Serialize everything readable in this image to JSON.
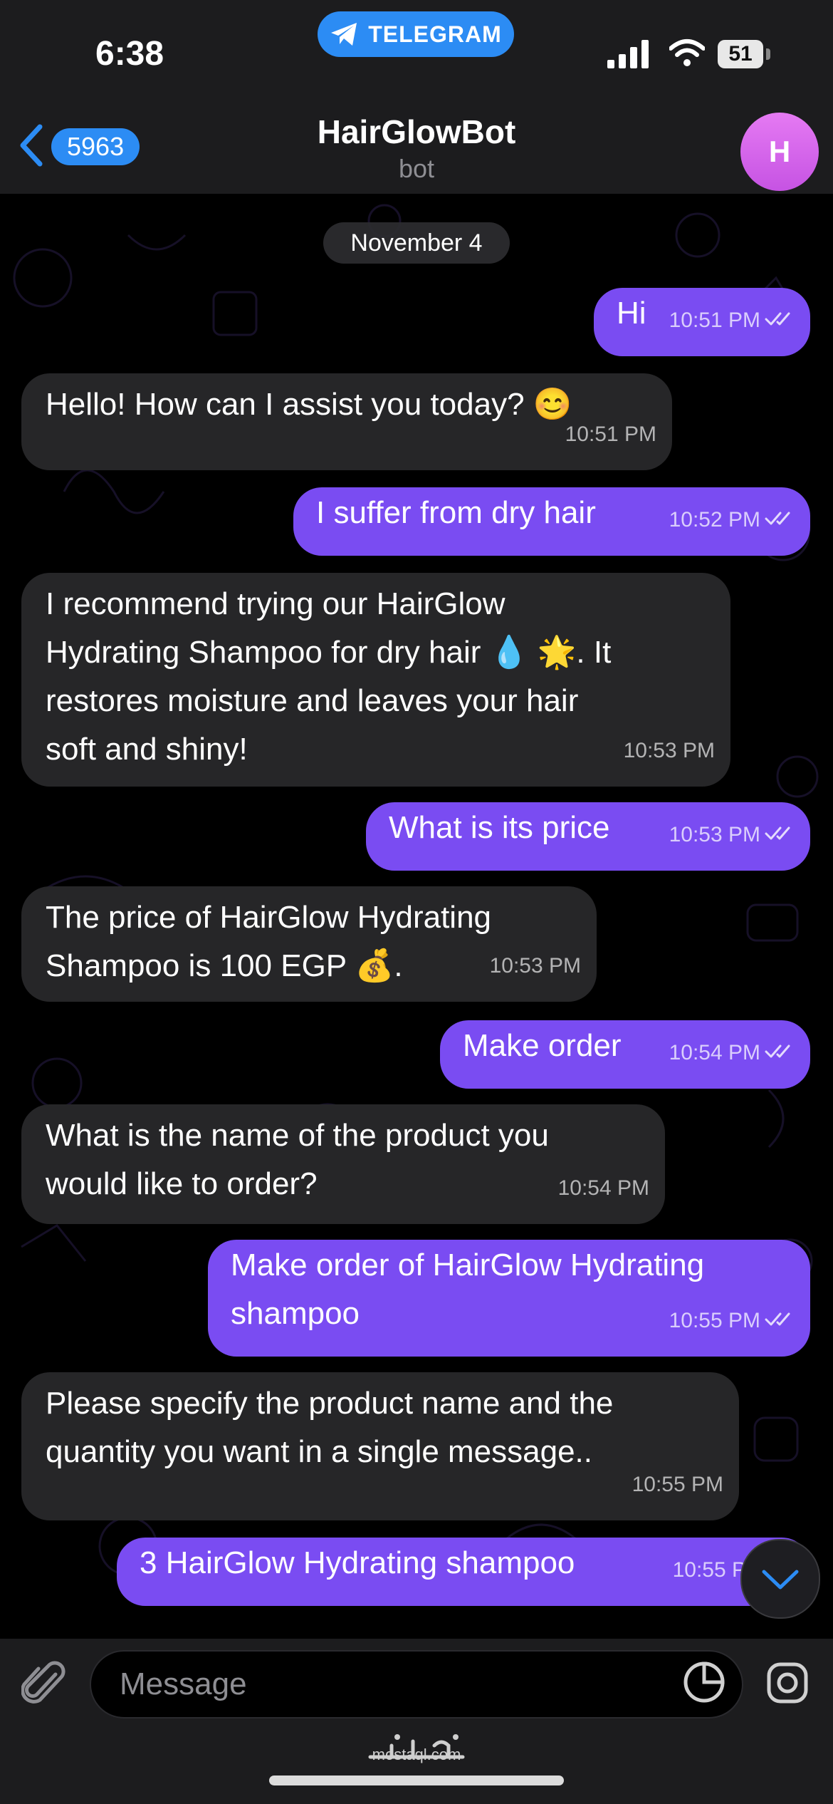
{
  "status_bar": {
    "time": "6:38",
    "app_pill": "TELEGRAM",
    "battery": "51"
  },
  "header": {
    "back_count": "5963",
    "title": "HairGlowBot",
    "subtitle": "bot",
    "avatar_letter": "H"
  },
  "date_chip": "November 4",
  "messages": [
    {
      "dir": "out",
      "text": "Hi",
      "time": "10:51 PM"
    },
    {
      "dir": "in",
      "text": "Hello! How can I assist you today? 😊",
      "time": "10:51 PM"
    },
    {
      "dir": "out",
      "text": "I suffer from dry hair",
      "time": "10:52 PM"
    },
    {
      "dir": "in",
      "text": "I recommend trying our HairGlow\nHydrating Shampoo for dry hair 💧 🌟. It\nrestores moisture and leaves your hair\nsoft and shiny!",
      "time": "10:53 PM"
    },
    {
      "dir": "out",
      "text": "What is its price",
      "time": "10:53 PM"
    },
    {
      "dir": "in",
      "text": "The price of HairGlow Hydrating\nShampoo is 100 EGP 💰.",
      "time": "10:53 PM"
    },
    {
      "dir": "out",
      "text": "Make order",
      "time": "10:54 PM"
    },
    {
      "dir": "in",
      "text": "What is the name of the product you\nwould like to order?",
      "time": "10:54 PM"
    },
    {
      "dir": "out",
      "text": "Make order of HairGlow Hydrating\nshampoo",
      "time": "10:55 PM"
    },
    {
      "dir": "in",
      "text": "Please specify the product name  and the\nquantity you want in a single message..",
      "time": "10:55 PM"
    },
    {
      "dir": "out",
      "text": "3 HairGlow Hydrating shampoo",
      "time": "10:55 P"
    }
  ],
  "input": {
    "placeholder": "Message"
  },
  "watermark": {
    "arabic": "مستقل",
    "latin": "mostaql.com"
  },
  "icons": [
    "chevron-left-icon",
    "paperclip-icon",
    "sticker-icon",
    "camera-icon",
    "chevron-down-icon",
    "double-check-icon",
    "paper-plane-icon"
  ],
  "colors": {
    "outgoing_bubble": "#7a4cf2",
    "incoming_bubble": "#262628",
    "accent": "#2c8cf4",
    "avatar": "#d463ea"
  }
}
